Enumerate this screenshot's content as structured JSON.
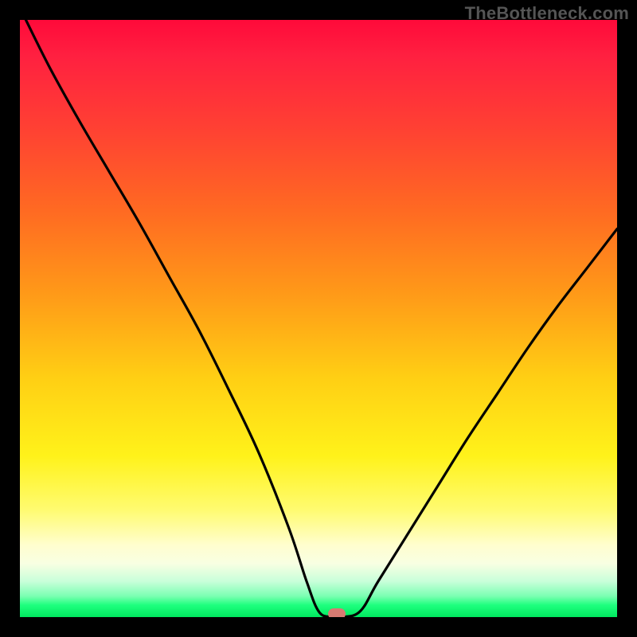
{
  "watermark": "TheBottleneck.com",
  "colors": {
    "top": "#ff0a3a",
    "mid": "#fff21a",
    "bottom": "#00e85f",
    "curve": "#000000",
    "marker": "#d77a72",
    "page_bg": "#000000"
  },
  "chart_data": {
    "type": "line",
    "title": "",
    "xlabel": "",
    "ylabel": "",
    "xlim": [
      0,
      100
    ],
    "ylim": [
      0,
      100
    ],
    "note": "Bottleneck-style V-curve over a vertical heat gradient. y≈100 means severe bottleneck (red), y≈0 means balanced (green). No numeric tick labels are rendered; y values are read off the gradient position.",
    "series": [
      {
        "name": "bottleneck-curve",
        "x": [
          1,
          5,
          10,
          15,
          20,
          25,
          30,
          35,
          40,
          45,
          48,
          50,
          52,
          54,
          57,
          60,
          65,
          70,
          75,
          80,
          85,
          90,
          95,
          100
        ],
        "y": [
          100,
          92,
          83,
          74.5,
          66,
          57,
          48,
          38,
          27.5,
          15,
          6,
          1,
          0,
          0,
          1,
          6,
          14,
          22,
          30,
          37.5,
          45,
          52,
          58.5,
          65
        ]
      }
    ],
    "marker": {
      "x": 53,
      "y": 0
    },
    "gradient_stops": [
      {
        "pos": 0,
        "color": "#ff0a3a"
      },
      {
        "pos": 0.32,
        "color": "#ff6a22"
      },
      {
        "pos": 0.6,
        "color": "#ffcf14"
      },
      {
        "pos": 0.82,
        "color": "#fffb70"
      },
      {
        "pos": 0.94,
        "color": "#c9ffda"
      },
      {
        "pos": 1.0,
        "color": "#00e85f"
      }
    ]
  }
}
